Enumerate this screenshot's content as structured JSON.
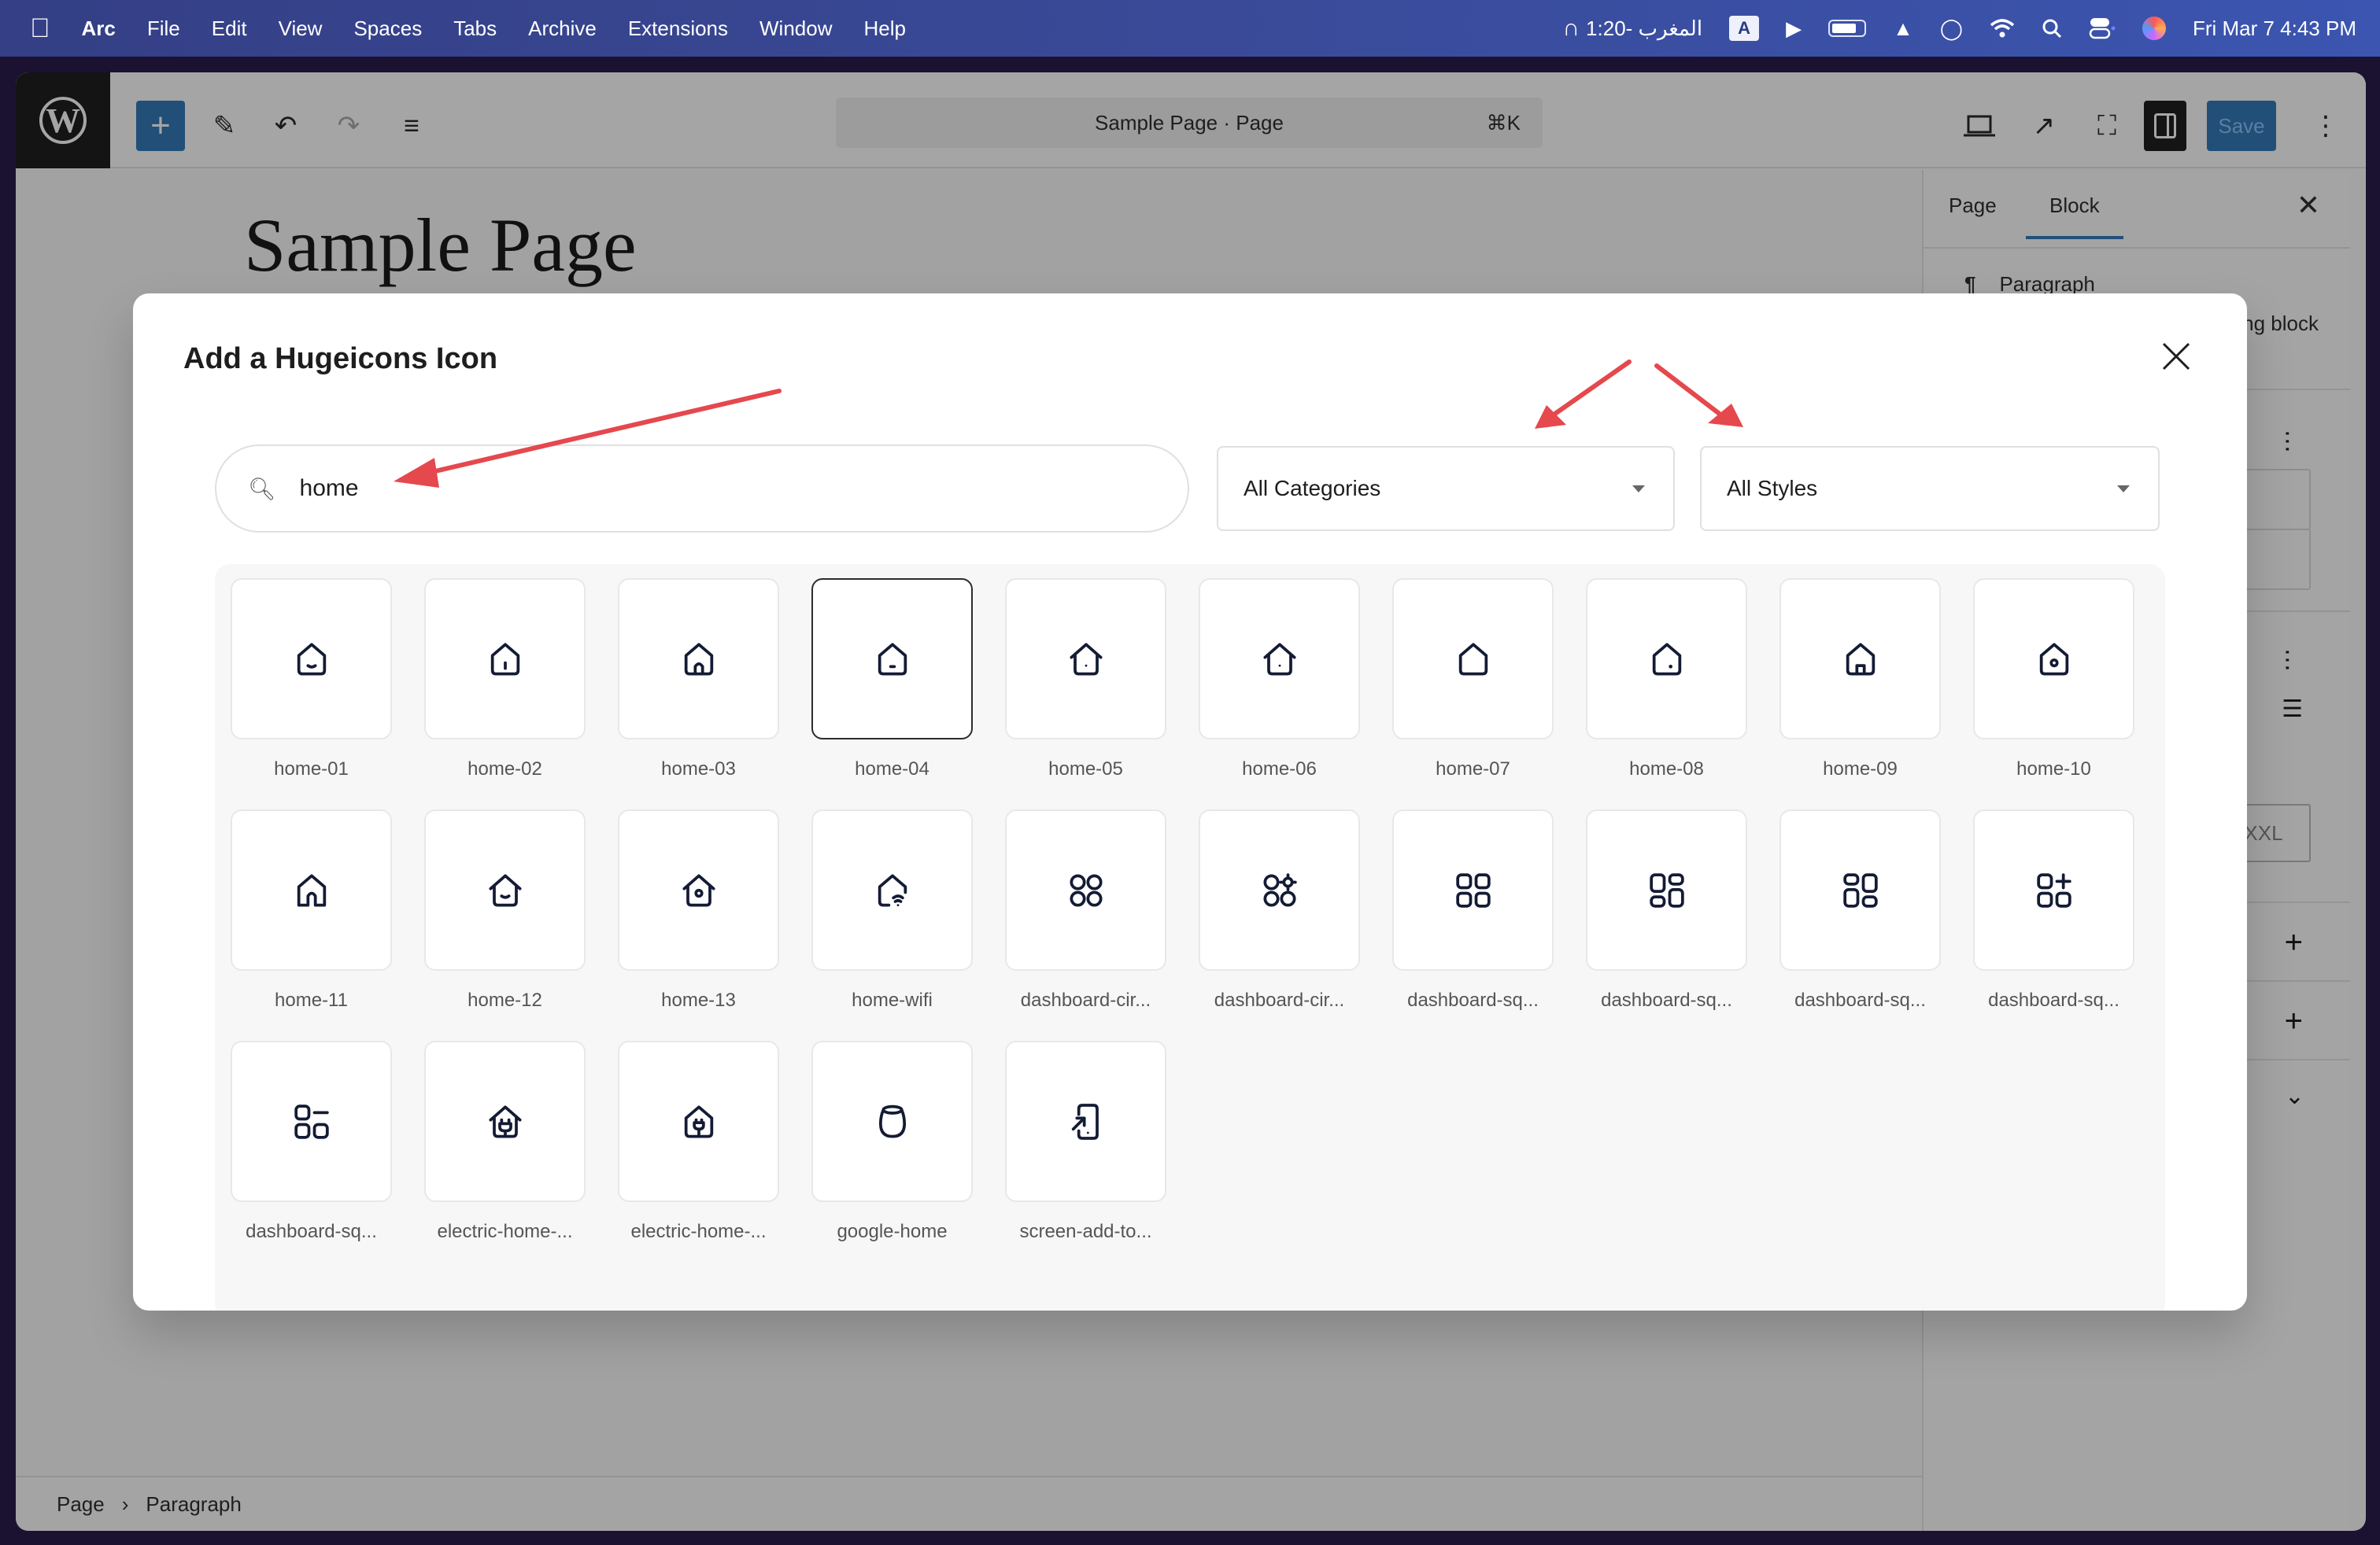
{
  "menubar": {
    "apple": "",
    "app": "Arc",
    "items": [
      "File",
      "Edit",
      "View",
      "Spaces",
      "Tabs",
      "Archive",
      "Extensions",
      "Window",
      "Help"
    ],
    "prayer_time": "المغرب -1:20",
    "input_source": "A",
    "datetime": "Fri Mar 7  4:43 PM"
  },
  "toolbar": {
    "document_title": "Sample Page · Page",
    "shortcut": "⌘K",
    "save_label": "Save",
    "add_label": "+"
  },
  "canvas": {
    "title_partial": "Sample Page"
  },
  "sidebar": {
    "tabs": [
      {
        "label": "Page",
        "active": false
      },
      {
        "label": "Block",
        "active": true
      }
    ],
    "block_name": "Paragraph",
    "block_desc_partial": "ng block",
    "size_option": "XXL"
  },
  "footer": {
    "breadcrumb": [
      "Page",
      "Paragraph"
    ]
  },
  "modal": {
    "title": "Add a Hugeicons Icon",
    "search": {
      "value": "home",
      "placeholder": ""
    },
    "category_select": "All Categories",
    "style_select": "All Styles",
    "selected_icon": "home-04",
    "icons": [
      {
        "label": "home-01",
        "icon": "home-01"
      },
      {
        "label": "home-02",
        "icon": "home-02"
      },
      {
        "label": "home-03",
        "icon": "home-03"
      },
      {
        "label": "home-04",
        "icon": "home-04"
      },
      {
        "label": "home-05",
        "icon": "home-05"
      },
      {
        "label": "home-06",
        "icon": "home-06"
      },
      {
        "label": "home-07",
        "icon": "home-07"
      },
      {
        "label": "home-08",
        "icon": "home-08"
      },
      {
        "label": "home-09",
        "icon": "home-09"
      },
      {
        "label": "home-10",
        "icon": "home-10"
      },
      {
        "label": "home-11",
        "icon": "home-11"
      },
      {
        "label": "home-12",
        "icon": "home-12"
      },
      {
        "label": "home-13",
        "icon": "home-13"
      },
      {
        "label": "home-wifi",
        "icon": "home-wifi"
      },
      {
        "label": "dashboard-cir...",
        "icon": "dashboard-circle"
      },
      {
        "label": "dashboard-cir...",
        "icon": "dashboard-circle-settings"
      },
      {
        "label": "dashboard-sq...",
        "icon": "dashboard-square-01"
      },
      {
        "label": "dashboard-sq...",
        "icon": "dashboard-square-02"
      },
      {
        "label": "dashboard-sq...",
        "icon": "dashboard-square-03"
      },
      {
        "label": "dashboard-sq...",
        "icon": "dashboard-square-add"
      },
      {
        "label": "dashboard-sq...",
        "icon": "dashboard-square-remove"
      },
      {
        "label": "electric-home-...",
        "icon": "electric-home-01"
      },
      {
        "label": "electric-home-...",
        "icon": "electric-home-02"
      },
      {
        "label": "google-home",
        "icon": "google-home"
      },
      {
        "label": "screen-add-to...",
        "icon": "screen-add-to-home"
      }
    ]
  },
  "colors": {
    "accent": "#214f78",
    "annotation_arrow": "#e5484d",
    "icon_stroke": "#141b34"
  }
}
